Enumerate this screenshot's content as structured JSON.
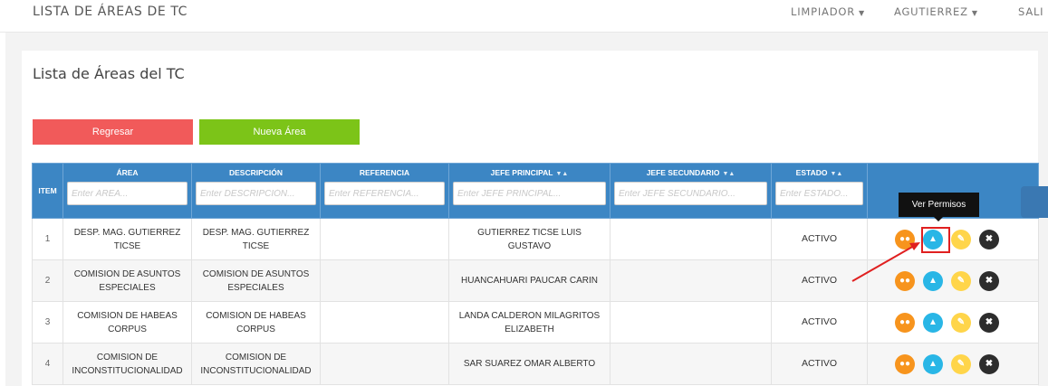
{
  "header": {
    "title": "LISTA DE ÁREAS DE TC",
    "nav": [
      {
        "label": "LIMPIADOR"
      },
      {
        "label": "AGUTIERREZ"
      },
      {
        "label": "SALI"
      }
    ]
  },
  "page": {
    "title": "Lista de Áreas del TC",
    "back_button": "Regresar",
    "new_button": "Nueva Área"
  },
  "table": {
    "columns": [
      {
        "label": "ITEM"
      },
      {
        "label": "ÁREA",
        "placeholder": "Enter ÁREA..."
      },
      {
        "label": "DESCRIPCIÓN",
        "placeholder": "Enter DESCRIPCIÓN..."
      },
      {
        "label": "REFERENCIA",
        "placeholder": "Enter REFERENCIA..."
      },
      {
        "label": "JEFE PRINCIPAL",
        "placeholder": "Enter JEFE PRINCIPAL...",
        "sort": "▼▲"
      },
      {
        "label": "JEFE SECUNDARIO",
        "placeholder": "Enter JEFE SECUNDARIO...",
        "sort": "▼▲"
      },
      {
        "label": "ESTADO",
        "placeholder": "Enter ESTADO...",
        "sort": "▼▲"
      },
      {
        "label": ""
      }
    ],
    "rows": [
      {
        "item": "1",
        "area": "DESP. MAG. GUTIERREZ TICSE",
        "descripcion": "DESP. MAG. GUTIERREZ TICSE",
        "referencia": "",
        "jefe_principal": "GUTIERREZ TICSE LUIS GUSTAVO",
        "jefe_secundario": "",
        "estado": "ACTIVO"
      },
      {
        "item": "2",
        "area": "COMISION DE ASUNTOS ESPECIALES",
        "descripcion": "COMISION DE ASUNTOS ESPECIALES",
        "referencia": "",
        "jefe_principal": "HUANCAHUARI PAUCAR CARIN",
        "jefe_secundario": "",
        "estado": "ACTIVO"
      },
      {
        "item": "3",
        "area": "COMISION DE HABEAS CORPUS",
        "descripcion": "COMISION DE HABEAS CORPUS",
        "referencia": "",
        "jefe_principal": "LANDA CALDERON MILAGRITOS ELIZABETH",
        "jefe_secundario": "",
        "estado": "ACTIVO"
      },
      {
        "item": "4",
        "area": "COMISION DE INCONSTITUCIONALIDAD",
        "descripcion": "COMISION DE INCONSTITUCIONALIDAD",
        "referencia": "",
        "jefe_principal": "SAR SUAREZ OMAR ALBERTO",
        "jefe_secundario": "",
        "estado": "ACTIVO"
      }
    ],
    "action_icons": [
      "users-icon",
      "user-icon",
      "edit-icon",
      "close-icon"
    ]
  },
  "tooltip": {
    "text": "Ver Permisos"
  },
  "colors": {
    "header_blue": "#3c86c4",
    "back_red": "#f15a5a",
    "new_green": "#7cc418",
    "action_orange": "#f7941d",
    "action_blue": "#29b6e6",
    "action_yellow": "#ffd54a",
    "action_dark": "#2d2d2d",
    "annotation_red": "#e02020"
  }
}
